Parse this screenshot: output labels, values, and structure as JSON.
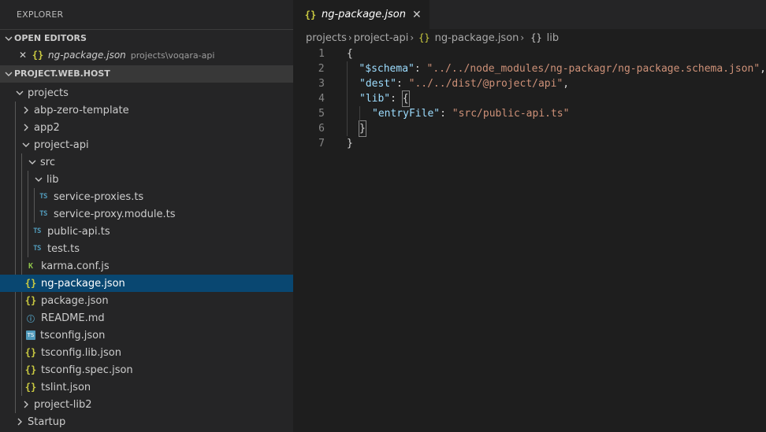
{
  "sidebar": {
    "title": "EXPLORER",
    "open_editors": {
      "header": "OPEN EDITORS",
      "items": [
        {
          "name": "ng-package.json",
          "path": "projects\\voqara-api"
        }
      ]
    },
    "project": {
      "header": "PROJECT.WEB.HOST",
      "tree": [
        {
          "label": "projects",
          "kind": "folder-open"
        },
        {
          "label": "abp-zero-template",
          "kind": "folder-closed"
        },
        {
          "label": "app2",
          "kind": "folder-closed"
        },
        {
          "label": "project-api",
          "kind": "folder-open"
        },
        {
          "label": "src",
          "kind": "folder-open"
        },
        {
          "label": "lib",
          "kind": "folder-open"
        },
        {
          "label": "service-proxies.ts",
          "kind": "ts"
        },
        {
          "label": "service-proxy.module.ts",
          "kind": "ts"
        },
        {
          "label": "public-api.ts",
          "kind": "ts"
        },
        {
          "label": "test.ts",
          "kind": "ts"
        },
        {
          "label": "karma.conf.js",
          "kind": "karma"
        },
        {
          "label": "ng-package.json",
          "kind": "json"
        },
        {
          "label": "package.json",
          "kind": "json"
        },
        {
          "label": "README.md",
          "kind": "info"
        },
        {
          "label": "tsconfig.json",
          "kind": "tsconfig"
        },
        {
          "label": "tsconfig.lib.json",
          "kind": "json"
        },
        {
          "label": "tsconfig.spec.json",
          "kind": "json"
        },
        {
          "label": "tslint.json",
          "kind": "json"
        },
        {
          "label": "project-lib2",
          "kind": "folder-closed"
        },
        {
          "label": "Startup",
          "kind": "folder-closed"
        }
      ]
    }
  },
  "editor": {
    "tab": {
      "name": "ng-package.json",
      "icon": "{}"
    },
    "breadcrumb": {
      "seg1": "projects",
      "seg2": "project-api",
      "seg3": "ng-package.json",
      "seg4": "lib",
      "json_icon": "{}",
      "object_icon": "{}"
    },
    "lines": {
      "1": {
        "n": "1",
        "t1": "{"
      },
      "2": {
        "n": "2",
        "key": "\"$schema\"",
        "colon": ": ",
        "val": "\"../../node_modules/ng-packagr/ng-package.schema.json\"",
        "end": ","
      },
      "3": {
        "n": "3",
        "key": "\"dest\"",
        "colon": ": ",
        "val": "\"../../dist/@project/api\"",
        "end": ","
      },
      "4": {
        "n": "4",
        "key": "\"lib\"",
        "colon": ": ",
        "brace": "{"
      },
      "5": {
        "n": "5",
        "key": "\"entryFile\"",
        "colon": ": ",
        "val": "\"src/public-api.ts\""
      },
      "6": {
        "n": "6",
        "brace": "}"
      },
      "7": {
        "n": "7",
        "t1": "}"
      }
    }
  },
  "colors": {
    "selection": "#094771",
    "json_icon": "#cbcb41",
    "ts_icon": "#519aba",
    "key": "#9cdcfe",
    "string": "#ce9178"
  }
}
